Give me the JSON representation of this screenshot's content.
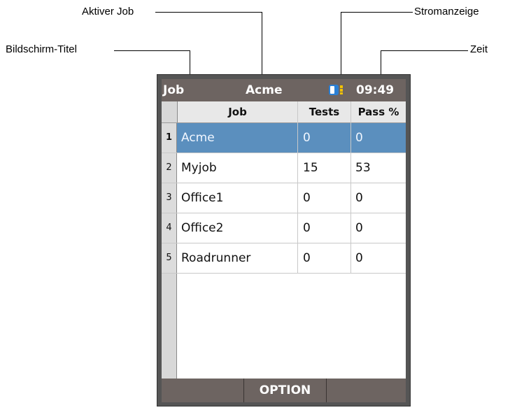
{
  "callouts": {
    "active_job": "Aktiver Job",
    "power": "Stromanzeige",
    "screen_title": "Bildschirm-Titel",
    "time": "Zeit"
  },
  "titlebar": {
    "screen_title": "Job",
    "active_job": "Acme",
    "time": "09:49",
    "battery_icon": "battery-icon"
  },
  "table": {
    "headers": [
      "Job",
      "Tests",
      "Pass %"
    ],
    "rows": [
      {
        "num": "1",
        "job": "Acme",
        "tests": "0",
        "pass": "0",
        "selected": true
      },
      {
        "num": "2",
        "job": "Myjob",
        "tests": "15",
        "pass": "53"
      },
      {
        "num": "3",
        "job": "Office1",
        "tests": "0",
        "pass": "0"
      },
      {
        "num": "4",
        "job": "Office2",
        "tests": "0",
        "pass": "0"
      },
      {
        "num": "5",
        "job": "Roadrunner",
        "tests": "0",
        "pass": "0"
      }
    ]
  },
  "softkeys": {
    "left": "",
    "middle": "OPTION",
    "right": ""
  },
  "colors": {
    "selected_row": "#5b8fbe",
    "titlebar": "#6d6461",
    "battery_blue": "#2a7fd4",
    "battery_yellow": "#f2c200"
  }
}
